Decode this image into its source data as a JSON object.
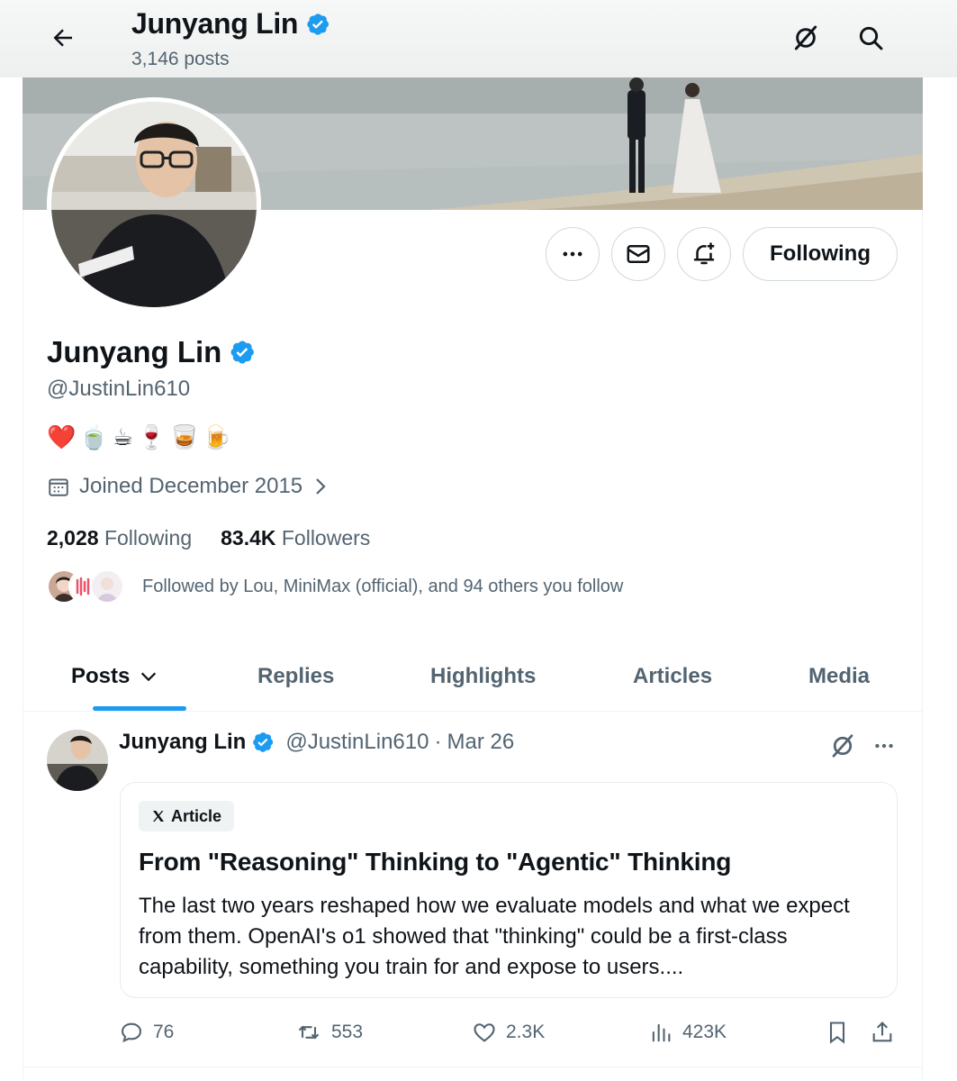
{
  "header": {
    "title": "Junyang Lin",
    "posts_count": "3,146 posts"
  },
  "profile": {
    "name": "Junyang Lin",
    "handle": "@JustinLin610",
    "bio_emojis": [
      "❤️",
      "🍵",
      "☕",
      "🍷",
      "🥃",
      "🍺"
    ],
    "joined": "Joined December 2015",
    "following_count": "2,028",
    "following_label": "Following",
    "followers_count": "83.4K",
    "followers_label": "Followers",
    "followed_by": "Followed by Lou, MiniMax (official), and 94 others you follow"
  },
  "buttons": {
    "follow_label": "Following"
  },
  "tabs": [
    {
      "label": "Posts",
      "active": true
    },
    {
      "label": "Replies"
    },
    {
      "label": "Highlights"
    },
    {
      "label": "Articles"
    },
    {
      "label": "Media"
    }
  ],
  "post": {
    "author_name": "Junyang Lin",
    "author_handle": "@JustinLin610",
    "date": "Mar 26",
    "meta_sep": "·",
    "article_badge": "Article",
    "article_title": "From \"Reasoning\" Thinking to \"Agentic\" Thinking",
    "article_body": "The last two years reshaped how we evaluate models and what we expect from them. OpenAI's o1 showed that \"thinking\" could be a first-class capability, something you train for and expose to users....",
    "replies": "76",
    "reposts": "553",
    "likes": "2.3K",
    "views": "423K"
  },
  "colors": {
    "accent": "#1d9bf0",
    "verified": "#1d9bf0",
    "text": "#0f1419",
    "secondary": "#536471",
    "border": "#cfd9de"
  }
}
